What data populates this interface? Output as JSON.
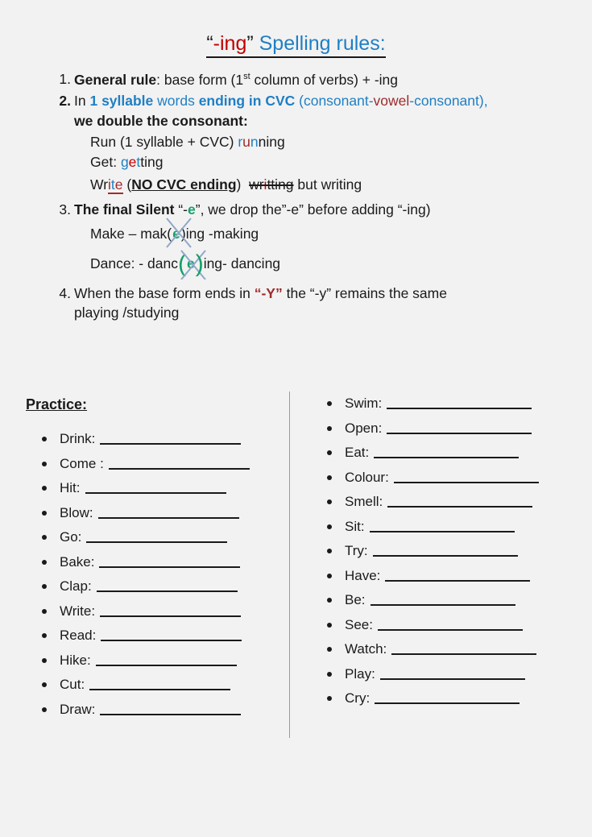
{
  "document": {
    "background_color": "#f2f2f2",
    "title": {
      "open_quote": "“",
      "ing": "-ing",
      "close_quote": "”",
      "rest": " Spelling rules:"
    },
    "colors": {
      "red": "#c00000",
      "blue": "#1f7fc4",
      "dark_red": "#9e2a2b",
      "green": "#14a06a",
      "text": "#1a1a1a",
      "divider": "#9a9a9a"
    }
  },
  "rules": [
    {
      "number": "1.",
      "label": "General rule",
      "colon": ":",
      "text_a": "   base form (1",
      "sup": "st",
      "text_b": " column of verbs) + -ing"
    },
    {
      "number": "2.",
      "in": "In ",
      "syllable": "1 syllable",
      "words": " words ",
      "ending": "ending in CVC",
      "paren_open": " (consonant-",
      "vowel": "vowel",
      "paren_close": "-consonant),",
      "line2": "we double the consonant:",
      "examples": [
        {
          "prefix": "Run (1 syllable + CVC) ",
          "letters": [
            {
              "ch": "r",
              "color": "blue"
            },
            {
              "ch": "u",
              "color": "dark_red"
            },
            {
              "ch": "n",
              "color": "blue"
            },
            {
              "ch": "ning",
              "color": "text"
            }
          ]
        },
        {
          "prefix": "Get: ",
          "letters": [
            {
              "ch": "g",
              "color": "blue"
            },
            {
              "ch": "e",
              "color": "red"
            },
            {
              "ch": "t",
              "color": "blue"
            },
            {
              "ch": "ting",
              "color": "text"
            }
          ]
        }
      ],
      "write_line": {
        "prefix": "Wr",
        "underlined": [
          {
            "ch": "i",
            "color": "dark_red"
          },
          {
            "ch": "t",
            "color": "blue"
          },
          {
            "ch": "e",
            "color": "dark_red"
          }
        ],
        "note_open": " (",
        "note": "NO   CVC ending",
        "note_close": ")",
        "wrong_pre": "wr",
        "wrong_mid": "i",
        "wrong_post": "tting",
        "but": "  but  writing"
      }
    },
    {
      "number": "3.",
      "label": "The final Silent",
      "quote_open": " “-",
      "e": "e",
      "quote_close": "”",
      "text": ", we drop the”-e” before adding “-ing)",
      "examples": [
        {
          "pre": "Make – mak(",
          "e": "e",
          "post": ")ing  -making"
        },
        {
          "pre": "Dance: - danc",
          "e": "e",
          "post": "ing-  dancing"
        }
      ]
    },
    {
      "number": "4.",
      "text_a": "When the base form ends  in ",
      "y": "“-Y”",
      "text_b": " the “-y” remains the same",
      "line2": "playing /studying"
    }
  ],
  "practice": {
    "heading": "Practice:",
    "left_column": [
      {
        "word": "Drink:",
        "blank_width": 175
      },
      {
        "word": "Come :",
        "blank_width": 175
      },
      {
        "word": "Hit:",
        "blank_width": 175
      },
      {
        "word": "Blow:",
        "blank_width": 175
      },
      {
        "word": "Go:",
        "blank_width": 175
      },
      {
        "word": "Bake:",
        "blank_width": 175
      },
      {
        "word": "Clap:",
        "blank_width": 175
      },
      {
        "word": "Write:",
        "blank_width": 175
      },
      {
        "word": "Read:",
        "blank_width": 175
      },
      {
        "word": "Hike:",
        "blank_width": 175
      },
      {
        "word": "Cut:",
        "blank_width": 175
      },
      {
        "word": "Draw:",
        "blank_width": 175
      }
    ],
    "right_column": [
      {
        "word": "Swim:",
        "blank_width": 180
      },
      {
        "word": "Open:",
        "blank_width": 180
      },
      {
        "word": "Eat:",
        "blank_width": 180
      },
      {
        "word": "Colour:",
        "blank_width": 180
      },
      {
        "word": "Smell:",
        "blank_width": 180
      },
      {
        "word": "Sit:",
        "blank_width": 180
      },
      {
        "word": "Try:",
        "blank_width": 180
      },
      {
        "word": "Have:",
        "blank_width": 180
      },
      {
        "word": "Be:",
        "blank_width": 180
      },
      {
        "word": "See:",
        "blank_width": 180
      },
      {
        "word": "Watch:",
        "blank_width": 180
      },
      {
        "word": "Play:",
        "blank_width": 180
      },
      {
        "word": "Cry:",
        "blank_width": 180
      }
    ]
  }
}
